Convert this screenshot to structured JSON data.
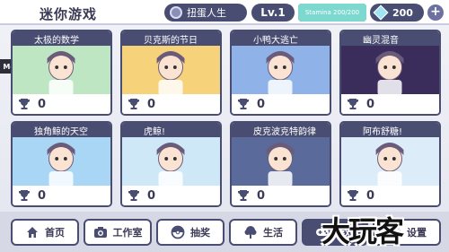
{
  "header": {
    "title": "迷你游戏",
    "gacha_label": "扭蛋人生",
    "level": "Lv.1",
    "stamina_text": "Stamina 200/200",
    "stamina_fraction": 1.0,
    "gems": "200",
    "plus_label": "+",
    "gacha_icon": "capsule-icon",
    "gem_icon": "diamond-icon"
  },
  "mod_tag": "Mod",
  "games": [
    {
      "title": "太极的数学",
      "score": "0",
      "theme": "#bfe6c2"
    },
    {
      "title": "贝克斯的节日",
      "score": "0",
      "theme": "#f6d27a"
    },
    {
      "title": "小鸭大逃亡",
      "score": "0",
      "theme": "#8fb2e8"
    },
    {
      "title": "幽灵混音",
      "score": "0",
      "theme": "#3a2d5c"
    },
    {
      "title": "独角鲸的天空",
      "score": "0",
      "theme": "#a8d6f4"
    },
    {
      "title": "虎鲸!",
      "score": "0",
      "theme": "#cfe8f8"
    },
    {
      "title": "皮克波克特韵律",
      "score": "0",
      "theme": "#5a6a9a"
    },
    {
      "title": "阿布舒糖!",
      "score": "0",
      "theme": "#dcecf8"
    }
  ],
  "nav": [
    {
      "label": "首页",
      "icon": "home-icon"
    },
    {
      "label": "工作室",
      "icon": "camera-icon"
    },
    {
      "label": "抽奖",
      "icon": "gacha-icon"
    },
    {
      "label": "生活",
      "icon": "tree-icon"
    },
    {
      "label": "游戏",
      "icon": "gamepad-icon"
    },
    {
      "label": "设置",
      "icon": "gear-icon"
    }
  ],
  "watermark": "大玩客"
}
